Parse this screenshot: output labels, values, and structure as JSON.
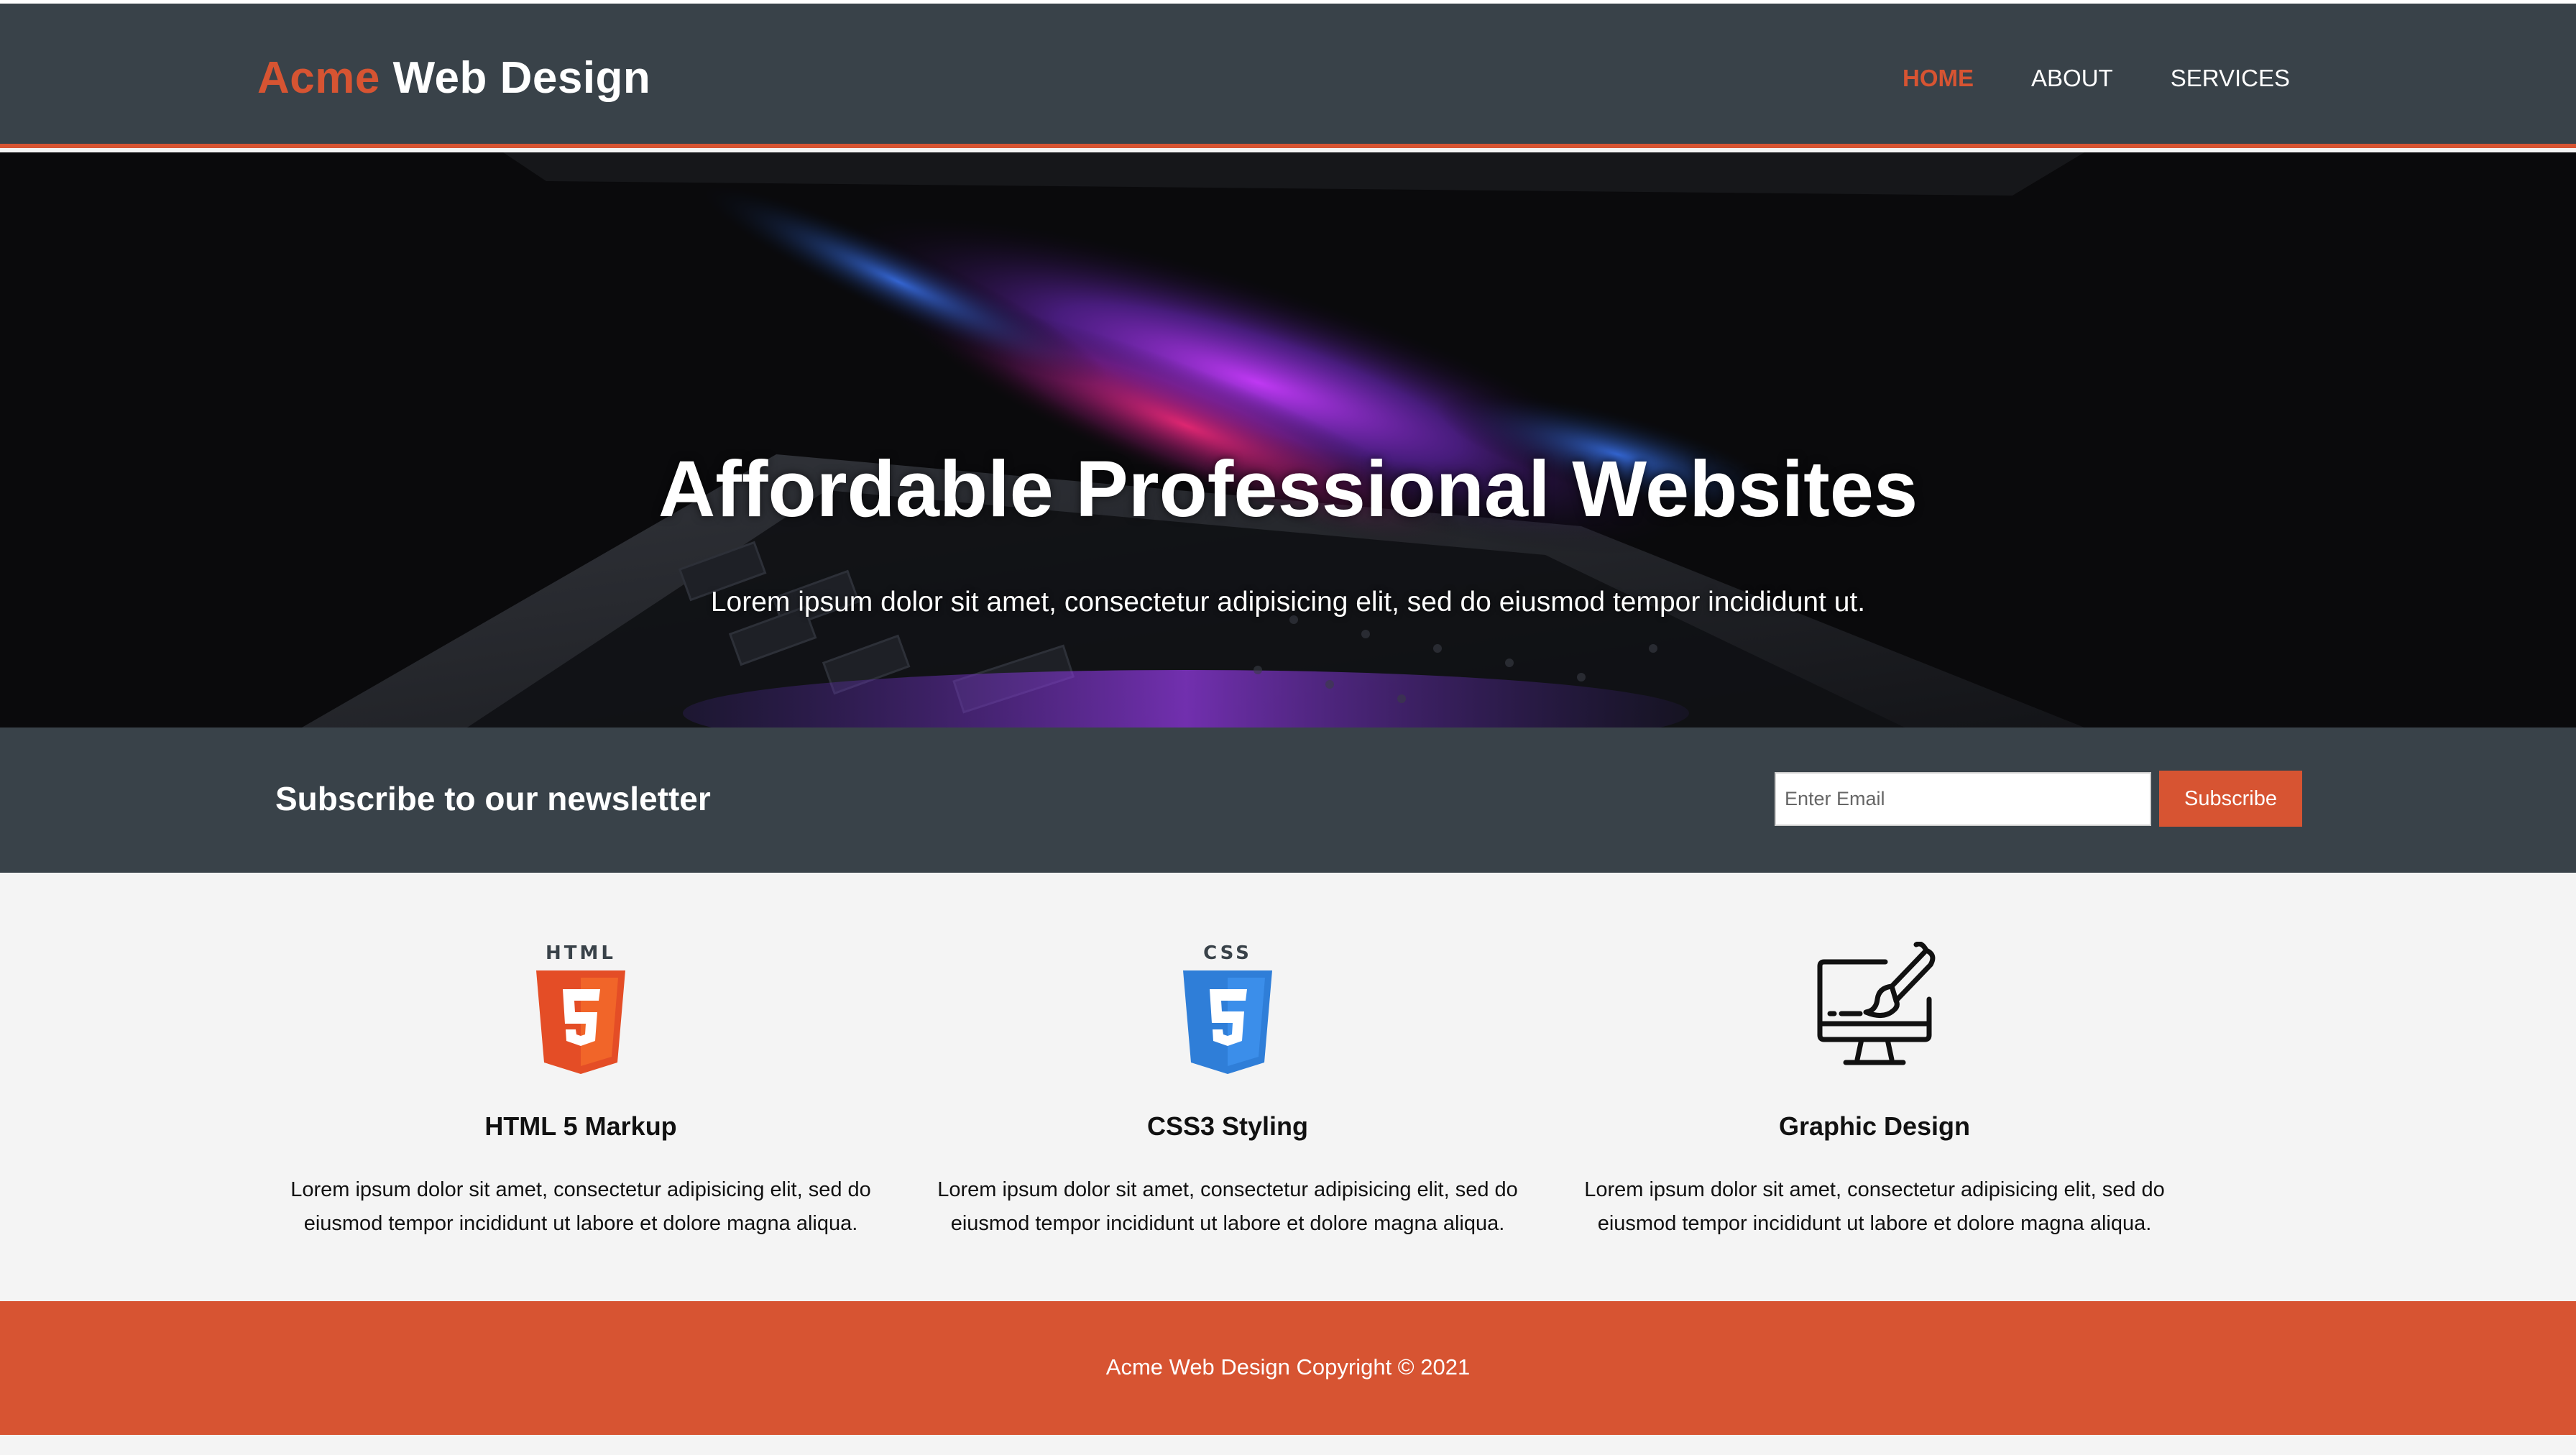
{
  "header": {
    "logo_highlight": "Acme",
    "logo_rest": "Web Design",
    "nav": [
      {
        "label": "HOME",
        "active": true
      },
      {
        "label": "ABOUT",
        "active": false
      },
      {
        "label": "SERVICES",
        "active": false
      }
    ]
  },
  "hero": {
    "title": "Affordable Professional Websites",
    "subtitle": "Lorem ipsum dolor sit amet, consectetur adipisicing elit, sed do eiusmod tempor incididunt ut."
  },
  "newsletter": {
    "heading": "Subscribe to our newsletter",
    "email_placeholder": "Enter Email",
    "button_label": "Subscribe"
  },
  "features": [
    {
      "icon": "html5-icon",
      "title": "HTML 5 Markup",
      "text": "Lorem ipsum dolor sit amet, consectetur adipisicing elit, sed do eiusmod tempor incididunt ut labore et dolore magna aliqua."
    },
    {
      "icon": "css3-icon",
      "title": "CSS3 Styling",
      "text": "Lorem ipsum dolor sit amet, consectetur adipisicing elit, sed do eiusmod tempor incididunt ut labore et dolore magna aliqua."
    },
    {
      "icon": "graphic-design-icon",
      "title": "Graphic Design",
      "text": "Lorem ipsum dolor sit amet, consectetur adipisicing elit, sed do eiusmod tempor incididunt ut labore et dolore magna aliqua."
    }
  ],
  "footer": {
    "copyright": "Acme Web Design Copyright © 2021"
  },
  "colors": {
    "accent": "#d75432",
    "dark": "#394249",
    "light_bg": "#f4f4f4",
    "html5_orange": "#e44d26",
    "css3_blue": "#3b8eea"
  }
}
